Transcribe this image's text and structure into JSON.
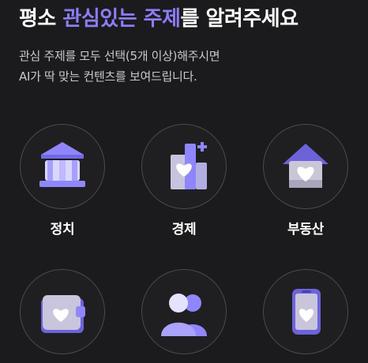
{
  "header": {
    "title_prefix": "평소 ",
    "title_highlight": "관심있는 주제",
    "title_suffix": "를 알려주세요",
    "subtitle_line1": "관심 주제를 모두 선택(5개 이상)해주시면",
    "subtitle_line2": "AI가 딱 맞는 컨텐츠를 보여드립니다."
  },
  "topics": [
    {
      "label": "정치",
      "icon": "government-building-icon"
    },
    {
      "label": "경제",
      "icon": "city-heart-icon"
    },
    {
      "label": "부동산",
      "icon": "house-heart-icon"
    },
    {
      "label": "",
      "icon": "wallet-heart-icon"
    },
    {
      "label": "",
      "icon": "people-icon"
    },
    {
      "label": "",
      "icon": "phone-heart-icon"
    }
  ],
  "colors": {
    "background": "#1b1b1d",
    "accent": "#8b7dff",
    "circle_border": "#4a4a50",
    "text_secondary": "#c9c9cf"
  }
}
